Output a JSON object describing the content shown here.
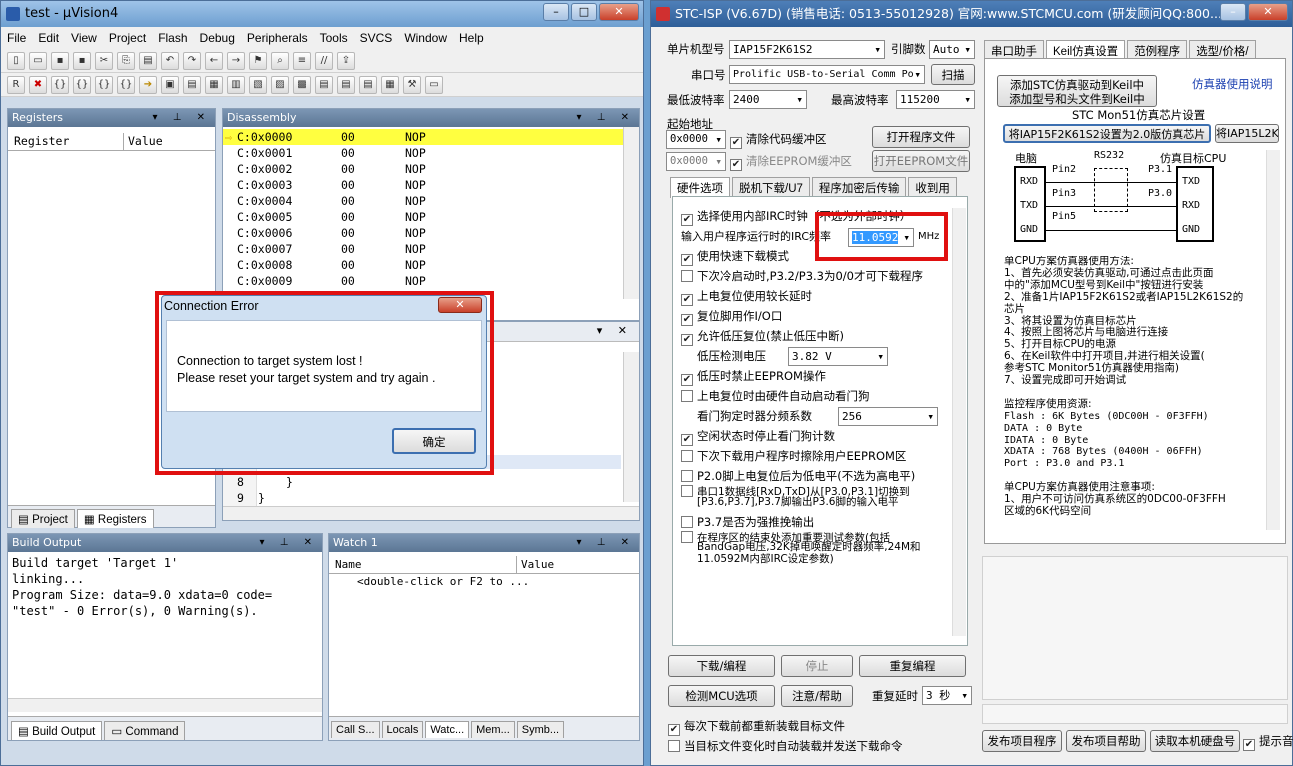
{
  "uv": {
    "title": "test - µVision4",
    "menu": [
      "File",
      "Edit",
      "View",
      "Project",
      "Flash",
      "Debug",
      "Peripherals",
      "Tools",
      "SVCS",
      "Window",
      "Help"
    ],
    "registers_title": "Registers",
    "reg_col1": "Register",
    "reg_col2": "Value",
    "disasm_title": "Disassembly",
    "disasm": [
      {
        "addr": "C:0x0000",
        "op": "00",
        "ins": "NOP"
      },
      {
        "addr": "C:0x0001",
        "op": "00",
        "ins": "NOP"
      },
      {
        "addr": "C:0x0002",
        "op": "00",
        "ins": "NOP"
      },
      {
        "addr": "C:0x0003",
        "op": "00",
        "ins": "NOP"
      },
      {
        "addr": "C:0x0004",
        "op": "00",
        "ins": "NOP"
      },
      {
        "addr": "C:0x0005",
        "op": "00",
        "ins": "NOP"
      },
      {
        "addr": "C:0x0006",
        "op": "00",
        "ins": "NOP"
      },
      {
        "addr": "C:0x0007",
        "op": "00",
        "ins": "NOP"
      },
      {
        "addr": "C:0x0008",
        "op": "00",
        "ins": "NOP"
      },
      {
        "addr": "C:0x0009",
        "op": "00",
        "ins": "NOP"
      }
    ],
    "code_lines": [
      {
        "n": "8",
        "t": "}"
      },
      {
        "n": "9",
        "t": "}"
      }
    ],
    "tab_project": "Project",
    "tab_registers": "Registers",
    "build_title": "Build Output",
    "build_lines": [
      "Build target 'Target 1'",
      "linking...",
      "Program Size: data=9.0 xdata=0 code=",
      "\"test\" - 0 Error(s), 0 Warning(s)."
    ],
    "watch_title": "Watch 1",
    "watch_col1": "Name",
    "watch_col2": "Value",
    "watch_row": "<double-click or F2 to ...",
    "tab_build": "Build Output",
    "tab_command": "Command",
    "bottom_tabs": [
      "Call S...",
      "Locals",
      "Watc...",
      "Mem...",
      "Symb..."
    ]
  },
  "dialog": {
    "title": "Connection Error",
    "line1": "Connection to target system lost !",
    "line2": "Please reset your target system and try again .",
    "ok": "确定"
  },
  "stc": {
    "title": "STC-ISP (V6.67D) (销售电话: 0513-55012928) 官网:www.STCMCU.com (研发顾问QQ:800...",
    "mcu_label": "单片机型号",
    "mcu": "IAP15F2K61S2",
    "pins_label": "引脚数",
    "pins": "Auto",
    "port_label": "串口号",
    "port": "Prolific USB-to-Serial Comm Po",
    "scan": "扫描",
    "min_baud_label": "最低波特率",
    "min_baud": "2400",
    "max_baud_label": "最高波特率",
    "max_baud": "115200",
    "start_addr": "起始地址",
    "addr1": "0x0000",
    "clear_code": "清除代码缓冲区",
    "open_prog": "打开程序文件",
    "addr2": "0x0000",
    "clear_eeprom": "清除EEPROM缓冲区",
    "open_eeprom": "打开EEPROM文件",
    "tabs": [
      "硬件选项",
      "脱机下载/U7",
      "程序加密后传输",
      "收到用"
    ],
    "opts": [
      "选择使用内部IRC时钟（不选为外部时钟）",
      "输入用户程序运行时的IRC频率",
      "使用快速下载模式",
      "下次冷启动时,P3.2/P3.3为0/0才可下载程序",
      "上电复位使用较长延时",
      "复位脚用作I/O口",
      "允许低压复位(禁止低压中断)",
      "低压检测电压",
      "低压时禁止EEPROM操作",
      "上电复位时由硬件自动启动看门狗",
      "看门狗定时器分频系数",
      "空闲状态时停止看门狗计数",
      "下次下载用户程序时擦除用户EEPROM区",
      "P2.0脚上电复位后为低电平(不选为高电平)",
      "串口1数据线[RxD,TxD]从[P3.0,P3.1]切换到",
      "[P3.6,P3.7],P3.7脚输出P3.6脚的输入电平",
      "P3.7是否为强推挽输出",
      "在程序区的结束处添加重要测试参数(包括",
      "BandGap电压,32K掉电唤醒定时器频率,24M和",
      "11.0592M内部IRC设定参数)"
    ],
    "irc_freq": "11.0592",
    "mhz": "MHz",
    "lvd": "3.82 V",
    "wdt": "256",
    "download": "下载/编程",
    "stop": "停止",
    "reprog": "重复编程",
    "check_mcu": "检测MCU选项",
    "help": "注意/帮助",
    "retry_delay": "重复延时",
    "retry_val": "3 秒",
    "reload": "每次下载前都重新装载目标文件",
    "autoload": "当目标文件变化时自动装载并发送下载命令",
    "right_tabs": [
      "串口助手",
      "Keil仿真设置",
      "范例程序",
      "选型/价格/"
    ],
    "add_keil": "添加STC仿真驱动到Keil中",
    "add_keil2": "添加型号和头文件到Keil中",
    "sim_help": "仿真器使用说明",
    "monitor_title": "STC Mon51仿真芯片设置",
    "set_btn": "将IAP15F2K61S2设置为2.0版仿真芯片",
    "set_btn2": "将IAP15L2K",
    "diag_pc": "电脑",
    "diag_rs232": "RS232",
    "diag_cpu": "仿真目标CPU",
    "diag_left": [
      "RXD",
      "TXD",
      "GND"
    ],
    "diag_pins": [
      "Pin2",
      "Pin3",
      "Pin5"
    ],
    "diag_p": [
      "P3.1",
      "P3.0"
    ],
    "diag_right": [
      "TXD",
      "RXD",
      "GND"
    ],
    "usage": [
      "单CPU方案仿真器使用方法:",
      "1、首先必须安装仿真驱动,可通过点击此页面",
      "中的\"添加MCU型号到Keil中\"按钮进行安装",
      "2、准备1片IAP15F2K61S2或者IAP15L2K61S2的",
      "芯片",
      "3、将其设置为仿真目标芯片",
      "4、按照上图将芯片与电脑进行连接",
      "5、打开目标CPU的电源",
      "6、在Keil软件中打开项目,并进行相关设置(",
      "参考STC Monitor51仿真器使用指南)",
      "7、设置完成即可开始调试",
      "",
      "监控程序使用资源:",
      "Flash : 6K Bytes (0DC00H - 0F3FFH)",
      "DATA  : 0 Byte",
      "IDATA : 0 Byte",
      "XDATA : 768 Bytes (0400H - 06FFH)",
      "Port  : P3.0 and P3.1",
      "",
      "单CPU方案仿真器使用注意事项:",
      "1、用户不可访问仿真系统区的0DC00-0F3FFH",
      "区域的6K代码空间"
    ],
    "b1": "发布项目程序",
    "b2": "发布项目帮助",
    "b3": "读取本机硬盘号",
    "b4": "提示音"
  },
  "colors": {
    "highlight": "#ffff40",
    "alert": "#e01010",
    "title_blue": "#6d9fd0"
  }
}
